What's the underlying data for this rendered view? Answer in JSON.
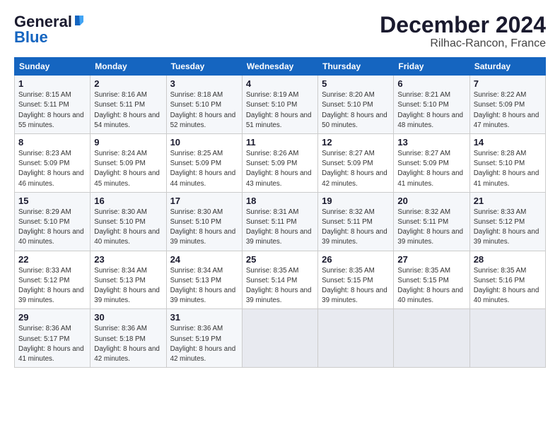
{
  "header": {
    "logo_general": "General",
    "logo_blue": "Blue",
    "title": "December 2024",
    "subtitle": "Rilhac-Rancon, France"
  },
  "columns": [
    "Sunday",
    "Monday",
    "Tuesday",
    "Wednesday",
    "Thursday",
    "Friday",
    "Saturday"
  ],
  "weeks": [
    [
      {
        "day": "1",
        "sunrise": "Sunrise: 8:15 AM",
        "sunset": "Sunset: 5:11 PM",
        "daylight": "Daylight: 8 hours and 55 minutes."
      },
      {
        "day": "2",
        "sunrise": "Sunrise: 8:16 AM",
        "sunset": "Sunset: 5:11 PM",
        "daylight": "Daylight: 8 hours and 54 minutes."
      },
      {
        "day": "3",
        "sunrise": "Sunrise: 8:18 AM",
        "sunset": "Sunset: 5:10 PM",
        "daylight": "Daylight: 8 hours and 52 minutes."
      },
      {
        "day": "4",
        "sunrise": "Sunrise: 8:19 AM",
        "sunset": "Sunset: 5:10 PM",
        "daylight": "Daylight: 8 hours and 51 minutes."
      },
      {
        "day": "5",
        "sunrise": "Sunrise: 8:20 AM",
        "sunset": "Sunset: 5:10 PM",
        "daylight": "Daylight: 8 hours and 50 minutes."
      },
      {
        "day": "6",
        "sunrise": "Sunrise: 8:21 AM",
        "sunset": "Sunset: 5:10 PM",
        "daylight": "Daylight: 8 hours and 48 minutes."
      },
      {
        "day": "7",
        "sunrise": "Sunrise: 8:22 AM",
        "sunset": "Sunset: 5:09 PM",
        "daylight": "Daylight: 8 hours and 47 minutes."
      }
    ],
    [
      {
        "day": "8",
        "sunrise": "Sunrise: 8:23 AM",
        "sunset": "Sunset: 5:09 PM",
        "daylight": "Daylight: 8 hours and 46 minutes."
      },
      {
        "day": "9",
        "sunrise": "Sunrise: 8:24 AM",
        "sunset": "Sunset: 5:09 PM",
        "daylight": "Daylight: 8 hours and 45 minutes."
      },
      {
        "day": "10",
        "sunrise": "Sunrise: 8:25 AM",
        "sunset": "Sunset: 5:09 PM",
        "daylight": "Daylight: 8 hours and 44 minutes."
      },
      {
        "day": "11",
        "sunrise": "Sunrise: 8:26 AM",
        "sunset": "Sunset: 5:09 PM",
        "daylight": "Daylight: 8 hours and 43 minutes."
      },
      {
        "day": "12",
        "sunrise": "Sunrise: 8:27 AM",
        "sunset": "Sunset: 5:09 PM",
        "daylight": "Daylight: 8 hours and 42 minutes."
      },
      {
        "day": "13",
        "sunrise": "Sunrise: 8:27 AM",
        "sunset": "Sunset: 5:09 PM",
        "daylight": "Daylight: 8 hours and 41 minutes."
      },
      {
        "day": "14",
        "sunrise": "Sunrise: 8:28 AM",
        "sunset": "Sunset: 5:10 PM",
        "daylight": "Daylight: 8 hours and 41 minutes."
      }
    ],
    [
      {
        "day": "15",
        "sunrise": "Sunrise: 8:29 AM",
        "sunset": "Sunset: 5:10 PM",
        "daylight": "Daylight: 8 hours and 40 minutes."
      },
      {
        "day": "16",
        "sunrise": "Sunrise: 8:30 AM",
        "sunset": "Sunset: 5:10 PM",
        "daylight": "Daylight: 8 hours and 40 minutes."
      },
      {
        "day": "17",
        "sunrise": "Sunrise: 8:30 AM",
        "sunset": "Sunset: 5:10 PM",
        "daylight": "Daylight: 8 hours and 39 minutes."
      },
      {
        "day": "18",
        "sunrise": "Sunrise: 8:31 AM",
        "sunset": "Sunset: 5:11 PM",
        "daylight": "Daylight: 8 hours and 39 minutes."
      },
      {
        "day": "19",
        "sunrise": "Sunrise: 8:32 AM",
        "sunset": "Sunset: 5:11 PM",
        "daylight": "Daylight: 8 hours and 39 minutes."
      },
      {
        "day": "20",
        "sunrise": "Sunrise: 8:32 AM",
        "sunset": "Sunset: 5:11 PM",
        "daylight": "Daylight: 8 hours and 39 minutes."
      },
      {
        "day": "21",
        "sunrise": "Sunrise: 8:33 AM",
        "sunset": "Sunset: 5:12 PM",
        "daylight": "Daylight: 8 hours and 39 minutes."
      }
    ],
    [
      {
        "day": "22",
        "sunrise": "Sunrise: 8:33 AM",
        "sunset": "Sunset: 5:12 PM",
        "daylight": "Daylight: 8 hours and 39 minutes."
      },
      {
        "day": "23",
        "sunrise": "Sunrise: 8:34 AM",
        "sunset": "Sunset: 5:13 PM",
        "daylight": "Daylight: 8 hours and 39 minutes."
      },
      {
        "day": "24",
        "sunrise": "Sunrise: 8:34 AM",
        "sunset": "Sunset: 5:13 PM",
        "daylight": "Daylight: 8 hours and 39 minutes."
      },
      {
        "day": "25",
        "sunrise": "Sunrise: 8:35 AM",
        "sunset": "Sunset: 5:14 PM",
        "daylight": "Daylight: 8 hours and 39 minutes."
      },
      {
        "day": "26",
        "sunrise": "Sunrise: 8:35 AM",
        "sunset": "Sunset: 5:15 PM",
        "daylight": "Daylight: 8 hours and 39 minutes."
      },
      {
        "day": "27",
        "sunrise": "Sunrise: 8:35 AM",
        "sunset": "Sunset: 5:15 PM",
        "daylight": "Daylight: 8 hours and 40 minutes."
      },
      {
        "day": "28",
        "sunrise": "Sunrise: 8:35 AM",
        "sunset": "Sunset: 5:16 PM",
        "daylight": "Daylight: 8 hours and 40 minutes."
      }
    ],
    [
      {
        "day": "29",
        "sunrise": "Sunrise: 8:36 AM",
        "sunset": "Sunset: 5:17 PM",
        "daylight": "Daylight: 8 hours and 41 minutes."
      },
      {
        "day": "30",
        "sunrise": "Sunrise: 8:36 AM",
        "sunset": "Sunset: 5:18 PM",
        "daylight": "Daylight: 8 hours and 42 minutes."
      },
      {
        "day": "31",
        "sunrise": "Sunrise: 8:36 AM",
        "sunset": "Sunset: 5:19 PM",
        "daylight": "Daylight: 8 hours and 42 minutes."
      },
      null,
      null,
      null,
      null
    ]
  ]
}
